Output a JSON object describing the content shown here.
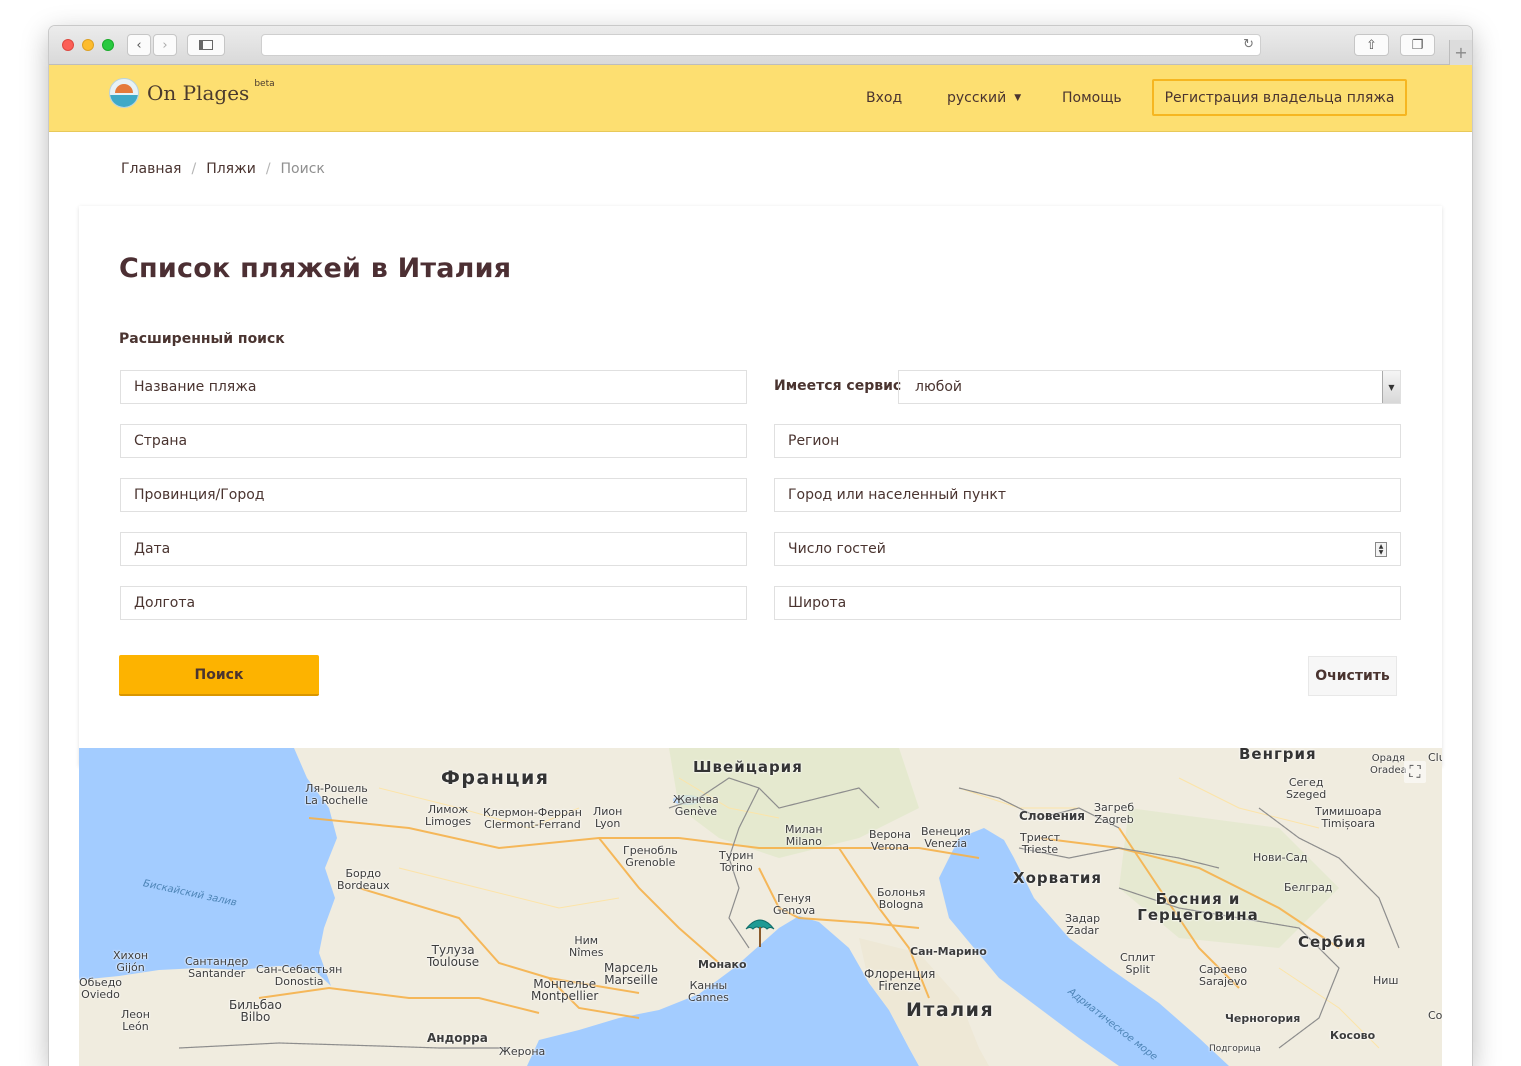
{
  "header": {
    "logo_text": "On Plages",
    "logo_beta": "beta",
    "nav": {
      "login": "Вход",
      "language": "русский",
      "help": "Помощь",
      "register_owner": "Регистрация владельца пляжа"
    }
  },
  "breadcrumb": [
    "Главная",
    "Пляжи",
    "Поиск"
  ],
  "page": {
    "title": "Список пляжей в Италия",
    "advanced_search": "Расширенный поиск"
  },
  "form": {
    "beach_name": "Название пляжа",
    "service_label": "Имеется сервис",
    "service_value": "любой",
    "country": "Страна",
    "region": "Регион",
    "province": "Провинция/Город",
    "city": "Город или населенный пункт",
    "date": "Дата",
    "guests": "Число гостей",
    "longitude": "Долгота",
    "latitude": "Широта",
    "search_button": "Поиск",
    "clear_button": "Очистить"
  },
  "map": {
    "countries": [
      "Франция",
      "Швейцария",
      "Венгрия",
      "Словения",
      "Хорватия",
      "Босния и Герцеговина",
      "Сербия",
      "Италия",
      "Андорра"
    ],
    "cities": [
      {
        "ru": "Ля-Рошель",
        "local": "La Rochelle"
      },
      {
        "ru": "Лимож",
        "local": "Limoges"
      },
      {
        "ru": "Клермон-Ферран",
        "local": "Clermont-Ferrand"
      },
      {
        "ru": "Лион",
        "local": "Lyon"
      },
      {
        "ru": "Женева",
        "local": "Genève"
      },
      {
        "ru": "Милан",
        "local": "Milano"
      },
      {
        "ru": "Верона",
        "local": "Verona"
      },
      {
        "ru": "Венеция",
        "local": "Venezia"
      },
      {
        "ru": "Загреб",
        "local": "Zagreb"
      },
      {
        "ru": "Сегед",
        "local": "Szeged"
      },
      {
        "ru": "Тимишоара",
        "local": "Timișoara"
      },
      {
        "ru": "Триест",
        "local": "Trieste"
      },
      {
        "ru": "Гренобль",
        "local": "Grenoble"
      },
      {
        "ru": "Турин",
        "local": "Torino"
      },
      {
        "ru": "Бордо",
        "local": "Bordeaux"
      },
      {
        "ru": "Генуя",
        "local": "Genova"
      },
      {
        "ru": "Болонья",
        "local": "Bologna"
      },
      {
        "ru": "Нови-Сад",
        "local": ""
      },
      {
        "ru": "Белград",
        "local": ""
      },
      {
        "ru": "Задар",
        "local": "Zadar"
      },
      {
        "ru": "Тулуза",
        "local": "Toulouse"
      },
      {
        "ru": "Ним",
        "local": "Nîmes"
      },
      {
        "ru": "Хихон",
        "local": "Gijón"
      },
      {
        "ru": "Сантандер",
        "local": "Santander"
      },
      {
        "ru": "Сан-Себастьян",
        "local": "Donostia"
      },
      {
        "ru": "Марсель",
        "local": "Marseille"
      },
      {
        "ru": "Монпелье",
        "local": "Montpellier"
      },
      {
        "ru": "Канны",
        "local": "Cannes"
      },
      {
        "ru": "Монако",
        "local": ""
      },
      {
        "ru": "Сан-Марино",
        "local": ""
      },
      {
        "ru": "Флоренция",
        "local": "Firenze"
      },
      {
        "ru": "Сплит",
        "local": "Split"
      },
      {
        "ru": "Сараево",
        "local": "Sarajevo"
      },
      {
        "ru": "Ниш",
        "local": ""
      },
      {
        "ru": "Обьедо",
        "local": "Oviedo"
      },
      {
        "ru": "Бильбао",
        "local": "Bilbo"
      },
      {
        "ru": "Леон",
        "local": "León"
      },
      {
        "ru": "Жерона",
        "local": ""
      },
      {
        "ru": "Черногория",
        "local": ""
      },
      {
        "ru": "Косово",
        "local": ""
      },
      {
        "ru": "Подгорица",
        "local": ""
      },
      {
        "ru": "Орадя",
        "local": "Oradea"
      },
      {
        "ru": "Clu",
        "local": ""
      },
      {
        "ru": "Co",
        "local": ""
      }
    ],
    "waters": [
      "Бискайский залив",
      "Адриатическое море"
    ],
    "fullscreen_icon": "fullscreen-icon",
    "marker_icon": "beach-umbrella-icon"
  },
  "colors": {
    "header_bg": "#fddf71",
    "primary_button": "#fdb300",
    "title_text": "#4c2f33",
    "sea": "#a3ccff",
    "land": "#f0ecdf"
  }
}
